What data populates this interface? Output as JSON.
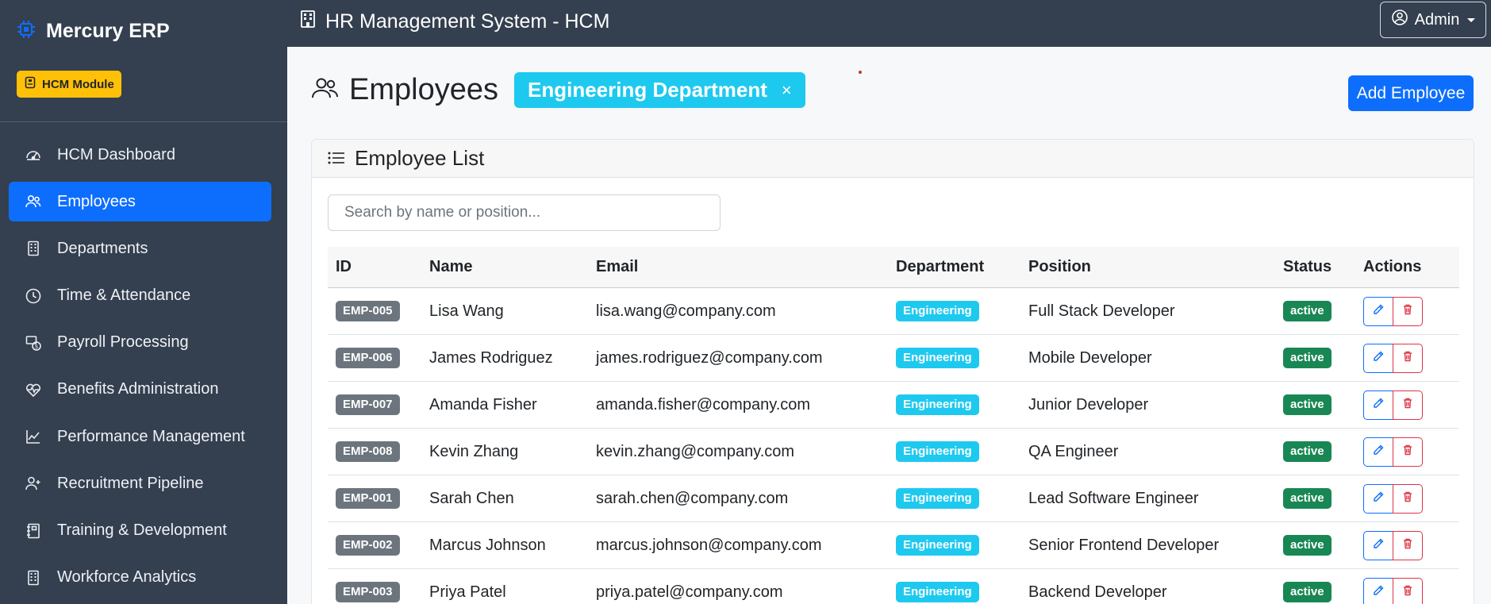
{
  "brand": {
    "name": "Mercury ERP",
    "icon": "cpu-icon"
  },
  "module_badge": {
    "label": "HCM Module",
    "icon": "badge-icon"
  },
  "sidebar": {
    "items": [
      {
        "label": "HCM Dashboard",
        "icon": "speedometer-icon",
        "active": false
      },
      {
        "label": "Employees",
        "icon": "people-icon",
        "active": true
      },
      {
        "label": "Departments",
        "icon": "building-icon",
        "active": false
      },
      {
        "label": "Time & Attendance",
        "icon": "clock-icon",
        "active": false
      },
      {
        "label": "Payroll Processing",
        "icon": "cash-icon",
        "active": false
      },
      {
        "label": "Benefits Administration",
        "icon": "heart-pulse-icon",
        "active": false
      },
      {
        "label": "Performance Management",
        "icon": "graph-up-icon",
        "active": false
      },
      {
        "label": "Recruitment Pipeline",
        "icon": "person-plus-icon",
        "active": false
      },
      {
        "label": "Training & Development",
        "icon": "journal-icon",
        "active": false
      },
      {
        "label": "Workforce Analytics",
        "icon": "building-icon",
        "active": false
      }
    ]
  },
  "topbar": {
    "title": "HR Management System - HCM",
    "user_label": "Admin"
  },
  "page": {
    "title": "Employees",
    "filter_label": "Engineering Department",
    "filter_clear": "×",
    "add_button": "Add Employee"
  },
  "card": {
    "title": "Employee List",
    "search_placeholder": "Search by name or position..."
  },
  "table": {
    "headers": {
      "id": "ID",
      "name": "Name",
      "email": "Email",
      "department": "Department",
      "position": "Position",
      "status": "Status",
      "actions": "Actions"
    },
    "rows": [
      {
        "id": "EMP-005",
        "name": "Lisa Wang",
        "email": "lisa.wang@company.com",
        "department": "Engineering",
        "position": "Full Stack Developer",
        "status": "active"
      },
      {
        "id": "EMP-006",
        "name": "James Rodriguez",
        "email": "james.rodriguez@company.com",
        "department": "Engineering",
        "position": "Mobile Developer",
        "status": "active"
      },
      {
        "id": "EMP-007",
        "name": "Amanda Fisher",
        "email": "amanda.fisher@company.com",
        "department": "Engineering",
        "position": "Junior Developer",
        "status": "active"
      },
      {
        "id": "EMP-008",
        "name": "Kevin Zhang",
        "email": "kevin.zhang@company.com",
        "department": "Engineering",
        "position": "QA Engineer",
        "status": "active"
      },
      {
        "id": "EMP-001",
        "name": "Sarah Chen",
        "email": "sarah.chen@company.com",
        "department": "Engineering",
        "position": "Lead Software Engineer",
        "status": "active"
      },
      {
        "id": "EMP-002",
        "name": "Marcus Johnson",
        "email": "marcus.johnson@company.com",
        "department": "Engineering",
        "position": "Senior Frontend Developer",
        "status": "active"
      },
      {
        "id": "EMP-003",
        "name": "Priya Patel",
        "email": "priya.patel@company.com",
        "department": "Engineering",
        "position": "Backend Developer",
        "status": "active"
      }
    ]
  },
  "colors": {
    "sidebar_bg": "#343f4f",
    "primary": "#0d6efd",
    "info": "#1ec9ef",
    "success": "#198754",
    "danger": "#dc3545",
    "warning": "#ffc107",
    "secondary": "#6c757d"
  }
}
